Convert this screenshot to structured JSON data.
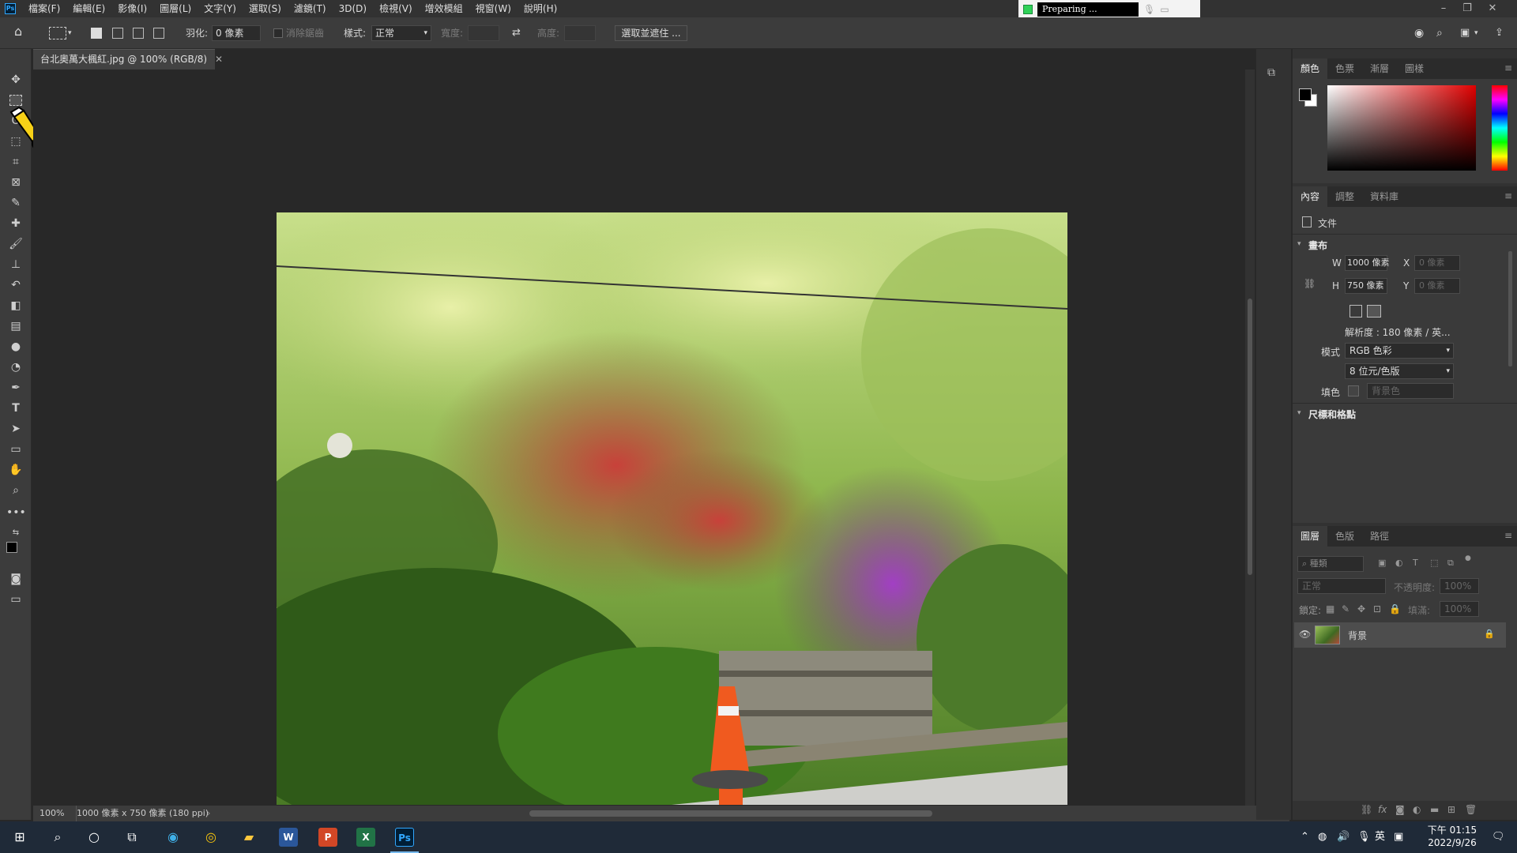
{
  "menubar": {
    "app_logo": "Ps",
    "items": [
      "檔案(F)",
      "編輯(E)",
      "影像(I)",
      "圖層(L)",
      "文字(Y)",
      "選取(S)",
      "濾鏡(T)",
      "3D(D)",
      "檢視(V)",
      "增效模組",
      "視窗(W)",
      "說明(H)"
    ]
  },
  "recorder": {
    "status": "Preparing ..."
  },
  "options": {
    "feather_label": "羽化:",
    "feather_value": "0 像素",
    "antialias_label": "消除鋸齒",
    "style_label": "樣式:",
    "style_value": "正常",
    "width_label": "寬度:",
    "height_label": "高度:",
    "select_mask_button": "選取並遮住 ..."
  },
  "document": {
    "tab_title": "台北奧萬大楓紅.jpg @ 100% (RGB/8)",
    "zoom": "100%",
    "info": "1000 像素 x 750 像素 (180 ppi)"
  },
  "color_panel": {
    "tabs": [
      "顏色",
      "色票",
      "漸層",
      "圖樣"
    ],
    "active": 0
  },
  "properties_panel": {
    "tabs": [
      "內容",
      "調整",
      "資料庫"
    ],
    "doc_label": "文件",
    "canvas_section": "畫布",
    "w_label": "W",
    "w_value": "1000 像素",
    "h_label": "H",
    "h_value": "750 像素",
    "x_label": "X",
    "x_value": "0 像素",
    "y_label": "Y",
    "y_value": "0 像素",
    "resolution": "解析度 : 180 像素 / 英...",
    "mode_label": "模式",
    "mode_value": "RGB 色彩",
    "depth_value": "8 位元/色版",
    "fill_label": "填色",
    "fill_value": "背景色",
    "rulers_section": "尺標和格點"
  },
  "layers_panel": {
    "tabs": [
      "圖層",
      "色版",
      "路徑"
    ],
    "search_placeholder": "種類",
    "blend_mode": "正常",
    "opacity_label": "不透明度:",
    "opacity_value": "100%",
    "lock_label": "鎖定:",
    "fill_label": "填滿:",
    "fill_value": "100%",
    "layer_name": "背景"
  },
  "taskbar": {
    "time": "下午 01:15",
    "date": "2022/9/26",
    "ime": "英",
    "apps": [
      "W",
      "P",
      "X",
      "Ps"
    ]
  },
  "colors": {
    "accent": "#31a8ff",
    "word": "#2b579a",
    "ppt": "#d24726",
    "excel": "#217346",
    "ps": "#001e36"
  }
}
